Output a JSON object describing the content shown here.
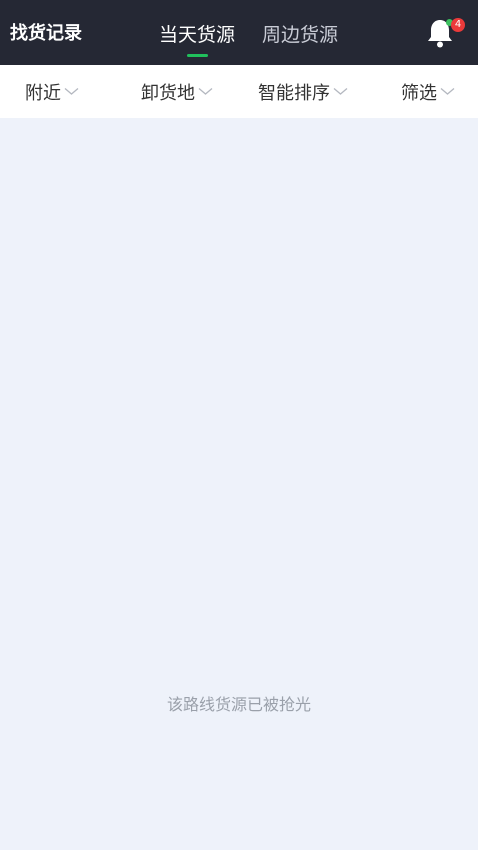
{
  "header": {
    "history_label": "找货记录",
    "tabs": [
      {
        "label": "当天货源",
        "active": true
      },
      {
        "label": "周边货源",
        "active": false
      }
    ],
    "notification_count": "4",
    "active_indicator_color": "#20c05c",
    "background_color": "#252834"
  },
  "filters": [
    {
      "label": "附近",
      "icon": "chevron-down-icon"
    },
    {
      "label": "卸货地",
      "icon": "chevron-down-icon"
    },
    {
      "label": "智能排序",
      "icon": "chevron-down-icon"
    },
    {
      "label": "筛选",
      "icon": "chevron-down-icon"
    }
  ],
  "content": {
    "empty_message": "该路线货源已被抢光"
  }
}
